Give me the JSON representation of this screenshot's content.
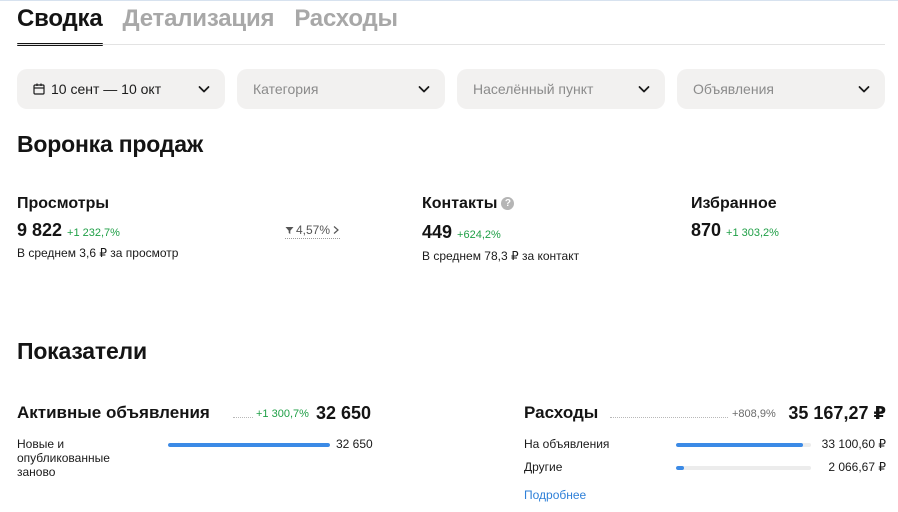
{
  "tabs": [
    {
      "label": "Сводка",
      "active": true
    },
    {
      "label": "Детализация",
      "active": false
    },
    {
      "label": "Расходы",
      "active": false
    }
  ],
  "filters": {
    "period": "10 сент — 10 окт",
    "category": "Категория",
    "city": "Населённый пункт",
    "ads": "Объявления"
  },
  "funnel": {
    "title": "Воронка продаж",
    "views": {
      "label": "Просмотры",
      "value": "9 822",
      "change": "+1 232,7%",
      "avg": "В среднем 3,6 ₽ за просмотр"
    },
    "conversion": "4,57%",
    "contacts": {
      "label": "Контакты",
      "value": "449",
      "change": "+624,2%",
      "avg": "В среднем 78,3 ₽ за контакт"
    },
    "favorites": {
      "label": "Избранное",
      "value": "870",
      "change": "+1 303,2%"
    }
  },
  "indicators": {
    "title": "Показатели",
    "active": {
      "label": "Активные объявления",
      "change": "+1 300,7%",
      "value": "32 650",
      "rows": [
        {
          "label": "Новые и опубликованные заново",
          "value": "32 650",
          "fraction": 1.0
        }
      ]
    },
    "expenses": {
      "label": "Расходы",
      "change": "+808,9%",
      "value": "35 167,27 ₽",
      "rows": [
        {
          "label": "На объявления",
          "value": "33 100,60 ₽",
          "fraction": 0.94
        },
        {
          "label": "Другие",
          "value": "2 066,67 ₽",
          "fraction": 0.06
        }
      ],
      "link": "Подробнее"
    }
  },
  "colors": {
    "accent": "#3b8ae6",
    "positive": "#1f9f46",
    "link": "#2f80d8"
  }
}
